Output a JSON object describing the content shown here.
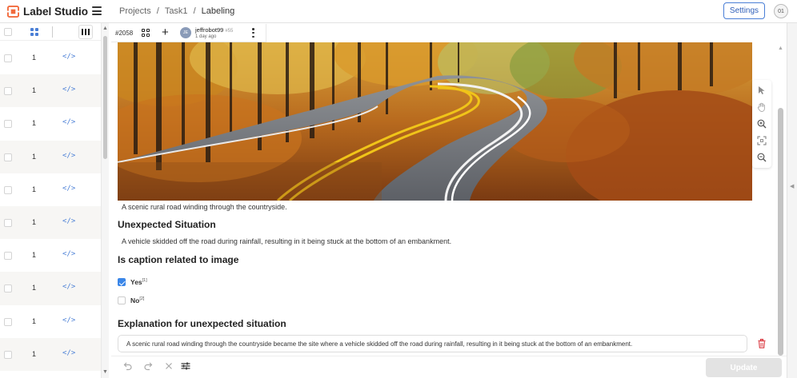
{
  "app": {
    "title": "Label Studio"
  },
  "breadcrumb": {
    "projects": "Projects",
    "sep": "/",
    "task": "Task1",
    "current": "Labeling"
  },
  "header": {
    "settings_label": "Settings",
    "user_initials": "01"
  },
  "task_list": {
    "rows": [
      {
        "num": "1",
        "code": "</>"
      },
      {
        "num": "1",
        "code": "</>"
      },
      {
        "num": "1",
        "code": "</>"
      },
      {
        "num": "1",
        "code": "</>"
      },
      {
        "num": "1",
        "code": "</>"
      },
      {
        "num": "1",
        "code": "</>"
      },
      {
        "num": "1",
        "code": "</>"
      },
      {
        "num": "1",
        "code": "</>"
      },
      {
        "num": "1",
        "code": "</>"
      },
      {
        "num": "1",
        "code": "</>"
      }
    ]
  },
  "annotation": {
    "task_id": "#2058",
    "avatar_initials": "JE",
    "user": "jeffrobot99",
    "annotation_id": "#55",
    "time": "1 day ago"
  },
  "content": {
    "caption": "A scenic rural road winding through the countryside.",
    "unexpected_heading": "Unexpected Situation",
    "unexpected_text": "A vehicle skidded off the road during rainfall, resulting in it being stuck at the bottom of an embankment.",
    "related_heading": "Is caption related to image",
    "options": [
      {
        "label": "Yes",
        "hotkey": "[1]",
        "checked": true
      },
      {
        "label": "No",
        "hotkey": "[2]",
        "checked": false
      }
    ],
    "explanation_heading": "Explanation for unexpected situation",
    "explanation_text": "A scenic rural road winding through the countryside became the site where a vehicle skidded off the road during rainfall, resulting in it being stuck at the bottom of an embankment."
  },
  "bottom": {
    "update_label": "Update"
  },
  "colors": {
    "accent": "#4a7fd6",
    "checkbox": "#3a86e8",
    "danger": "#d9363e"
  },
  "icons": [
    "hamburger-icon",
    "grid-icon",
    "columns-icon",
    "plus-icon",
    "kebab-icon",
    "pointer-icon",
    "hand-icon",
    "zoom-in-icon",
    "fit-icon",
    "zoom-out-icon",
    "undo-icon",
    "redo-icon",
    "close-icon",
    "sliders-icon",
    "trash-icon"
  ]
}
